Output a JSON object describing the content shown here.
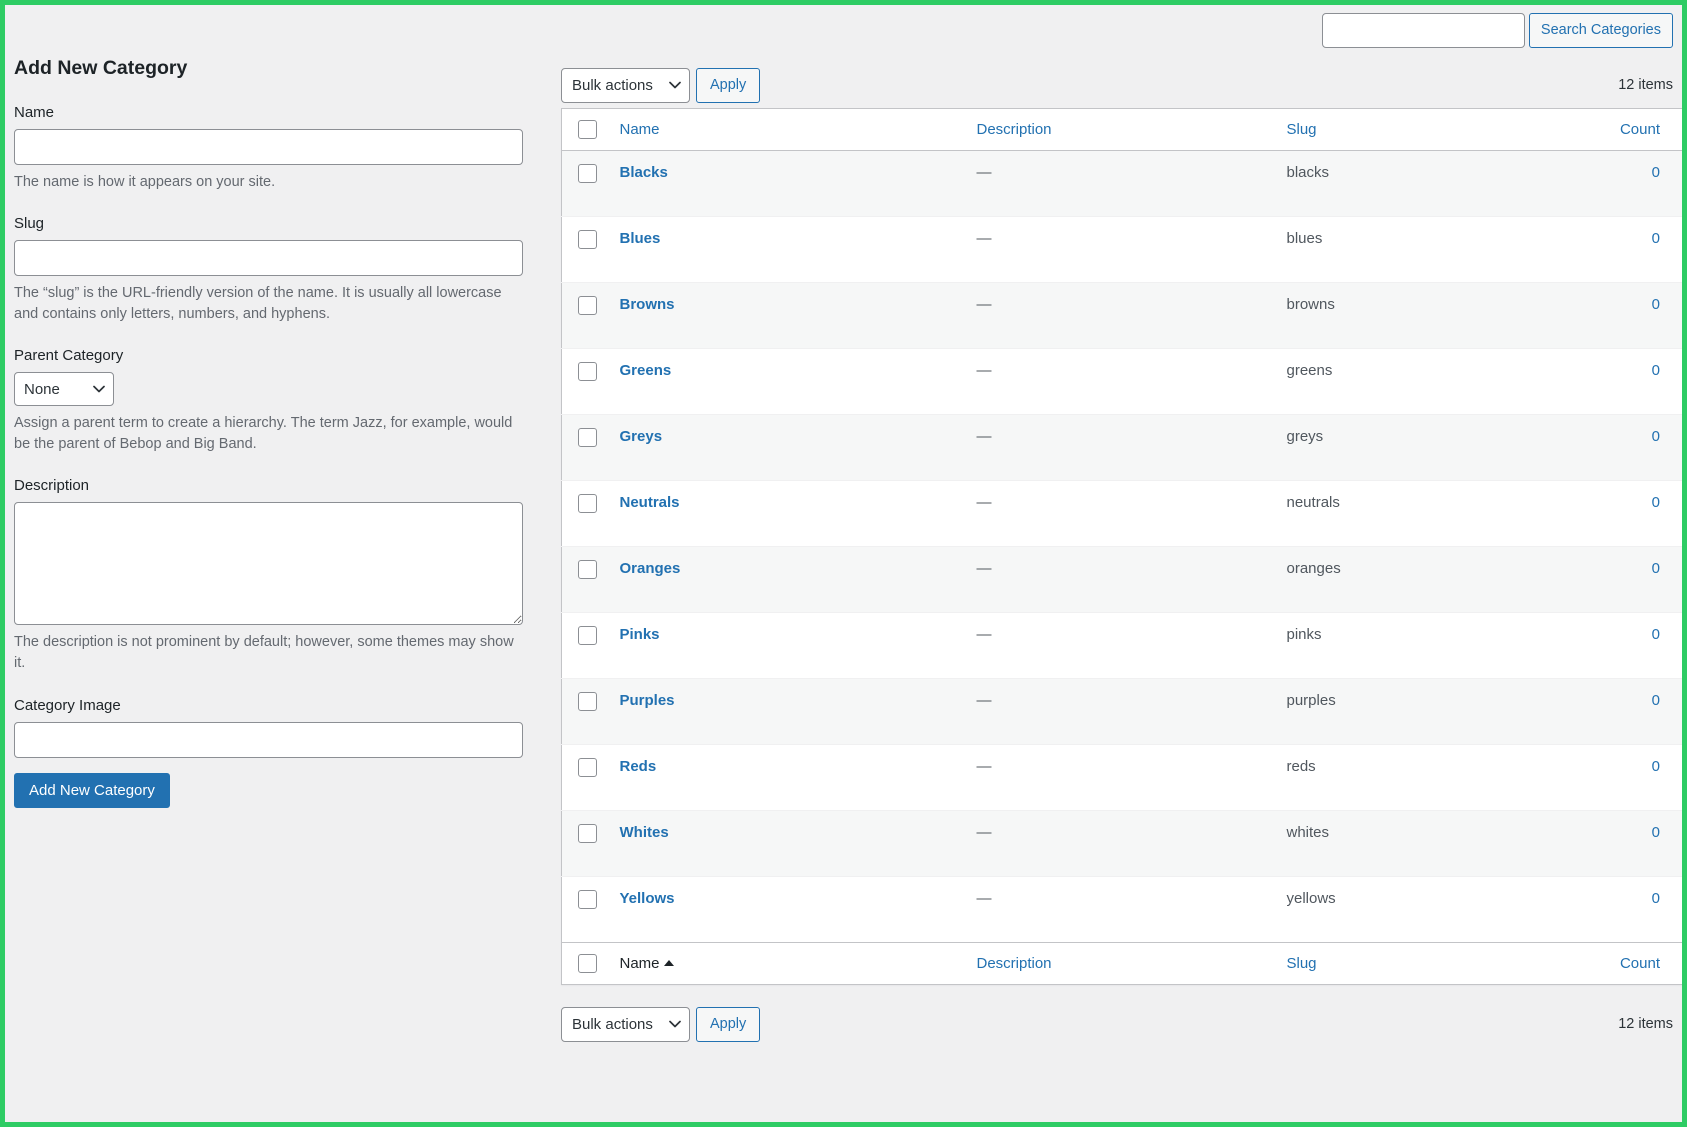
{
  "theme": {
    "accent_blue": "#2271b1",
    "border_green": "#2ecc64",
    "page_bg": "#f0f0f1",
    "row_alt_bg": "#f6f7f7",
    "text_dark": "#1d2327",
    "text_muted": "#646970"
  },
  "form": {
    "title": "Add New Category",
    "name_label": "Name",
    "name_value": "",
    "name_help": "The name is how it appears on your site.",
    "slug_label": "Slug",
    "slug_value": "",
    "slug_help": "The “slug” is the URL-friendly version of the name. It is usually all lowercase and contains only letters, numbers, and hyphens.",
    "parent_label": "Parent Category",
    "parent_selected": "None",
    "parent_options": [
      "None"
    ],
    "parent_help": "Assign a parent term to create a hierarchy. The term Jazz, for example, would be the parent of Bebop and Big Band.",
    "description_label": "Description",
    "description_value": "",
    "description_help": "The description is not prominent by default; however, some themes may show it.",
    "category_image_label": "Category Image",
    "category_image_value": "",
    "submit_label": "Add New Category"
  },
  "search": {
    "value": "",
    "button_label": "Search Categories"
  },
  "tablenav_top": {
    "bulk_selected": "Bulk actions",
    "bulk_options": [
      "Bulk actions"
    ],
    "apply_label": "Apply",
    "items_count": "12 items"
  },
  "tablenav_bottom": {
    "bulk_selected": "Bulk actions",
    "bulk_options": [
      "Bulk actions"
    ],
    "apply_label": "Apply",
    "items_count": "12 items"
  },
  "table": {
    "header": {
      "name": "Name",
      "description": "Description",
      "slug": "Slug",
      "count": "Count"
    },
    "footer": {
      "name": "Name",
      "description": "Description",
      "slug": "Slug",
      "count": "Count",
      "sorted_by": "Name",
      "sort_direction": "asc"
    },
    "dash": "—",
    "rows": [
      {
        "name": "Blacks",
        "description": "—",
        "slug": "blacks",
        "count": "0"
      },
      {
        "name": "Blues",
        "description": "—",
        "slug": "blues",
        "count": "0"
      },
      {
        "name": "Browns",
        "description": "—",
        "slug": "browns",
        "count": "0"
      },
      {
        "name": "Greens",
        "description": "—",
        "slug": "greens",
        "count": "0"
      },
      {
        "name": "Greys",
        "description": "—",
        "slug": "greys",
        "count": "0"
      },
      {
        "name": "Neutrals",
        "description": "—",
        "slug": "neutrals",
        "count": "0"
      },
      {
        "name": "Oranges",
        "description": "—",
        "slug": "oranges",
        "count": "0"
      },
      {
        "name": "Pinks",
        "description": "—",
        "slug": "pinks",
        "count": "0"
      },
      {
        "name": "Purples",
        "description": "—",
        "slug": "purples",
        "count": "0"
      },
      {
        "name": "Reds",
        "description": "—",
        "slug": "reds",
        "count": "0"
      },
      {
        "name": "Whites",
        "description": "—",
        "slug": "whites",
        "count": "0"
      },
      {
        "name": "Yellows",
        "description": "—",
        "slug": "yellows",
        "count": "0"
      }
    ]
  }
}
